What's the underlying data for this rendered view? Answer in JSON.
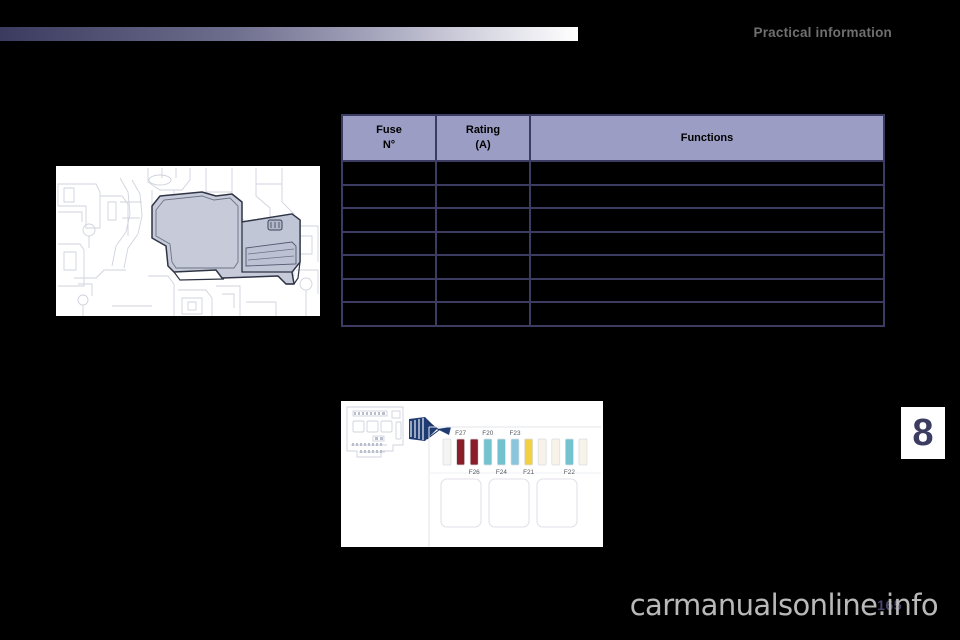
{
  "header": {
    "title": "Practical information",
    "band_color_start": "#3b3b5f",
    "band_color_end": "#ffffff"
  },
  "figures": {
    "engine_bay": {
      "name": "engine-bay-fuse-box-cover",
      "caption": "",
      "style": "line-art line drawing of engine compartment with shaded fuse box cover"
    },
    "fuse_box": {
      "name": "fuse-box-interior-fuse-row",
      "caption": "",
      "fuses": [
        {
          "label": "",
          "color": "#f4f4f2",
          "position": "top"
        },
        {
          "label": "F27",
          "color": "#8b1d28",
          "position": "top"
        },
        {
          "label": "F26",
          "color": "#8b1d28",
          "position": "bottom"
        },
        {
          "label": "F20",
          "color": "#72c3cf",
          "position": "top"
        },
        {
          "label": "F24",
          "color": "#72c3cf",
          "position": "bottom"
        },
        {
          "label": "F23",
          "color": "#8ac4dd",
          "position": "top"
        },
        {
          "label": "F21",
          "color": "#f2d040",
          "position": "bottom"
        },
        {
          "label": "",
          "color": "#f7f3e8",
          "position": "top"
        },
        {
          "label": "",
          "color": "#f7f3e8",
          "position": "top"
        },
        {
          "label": "F22",
          "color": "#72c3cf",
          "position": "bottom"
        },
        {
          "label": "",
          "color": "#f7f3e8",
          "position": "top"
        }
      ],
      "arrow_color": "#1f3b73"
    }
  },
  "fuse_table": {
    "columns": [
      {
        "key": "fuse_no",
        "label_line1": "Fuse",
        "label_line2": "N°"
      },
      {
        "key": "rating",
        "label_line1": "Rating",
        "label_line2": "(A)"
      },
      {
        "key": "functions",
        "label_line1": "Functions",
        "label_line2": ""
      }
    ],
    "header_bg": "#9b9dc4",
    "border_color": "#3c3c63",
    "rows": [
      {
        "fuse_no": "",
        "rating": "",
        "functions": ""
      },
      {
        "fuse_no": "",
        "rating": "",
        "functions": ""
      },
      {
        "fuse_no": "",
        "rating": "",
        "functions": ""
      },
      {
        "fuse_no": "",
        "rating": "",
        "functions": ""
      },
      {
        "fuse_no": "",
        "rating": "",
        "functions": ""
      },
      {
        "fuse_no": "",
        "rating": "",
        "functions": ""
      },
      {
        "fuse_no": "",
        "rating": "",
        "functions": ""
      }
    ]
  },
  "chapter_tab": {
    "number": "8",
    "color": "#3c3c63"
  },
  "footer": {
    "page_number": "165",
    "watermark": "carmanualsonline.info"
  }
}
